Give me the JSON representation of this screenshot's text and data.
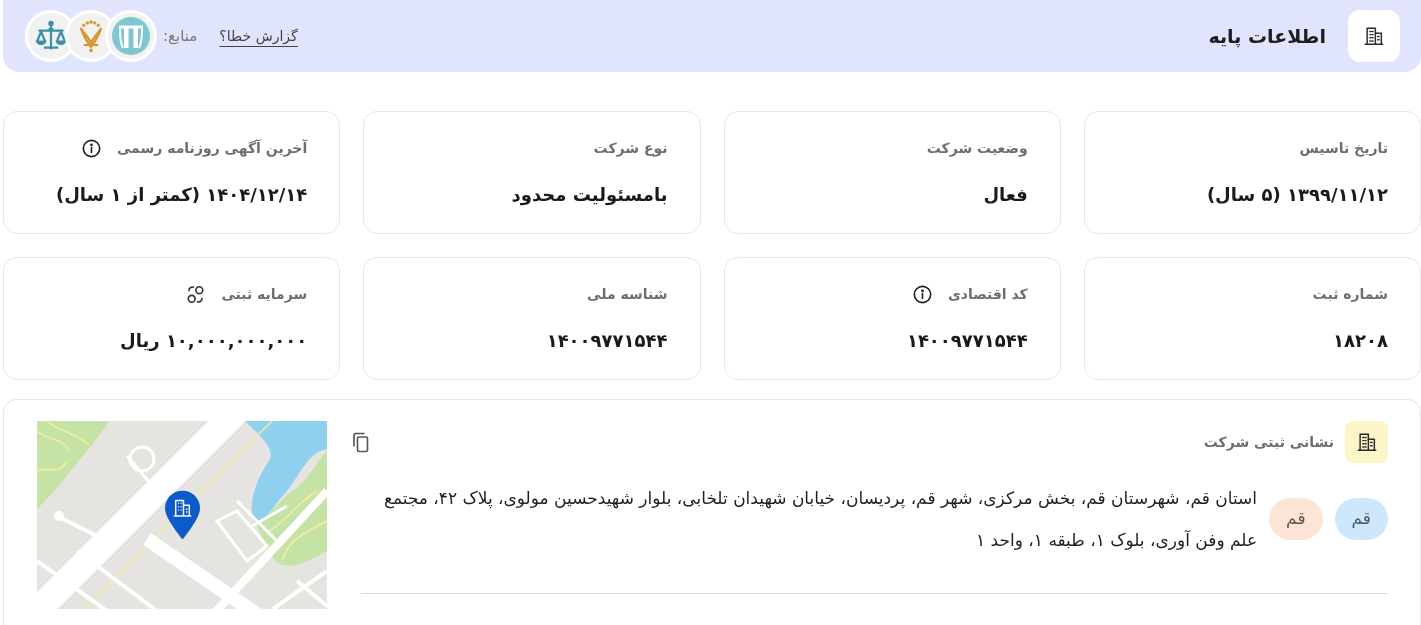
{
  "header": {
    "title": "اطلاعات پایه",
    "report_link": "گزارش خطا؟",
    "sources_label": "منابع:",
    "sources": [
      {
        "kind": "pillars"
      },
      {
        "kind": "crest"
      },
      {
        "kind": "scales"
      }
    ]
  },
  "fields": [
    {
      "label": "تاریخ تاسیس",
      "value": "۱۳۹۹/۱۱/۱۲ (۵ سال)",
      "kind": "plain"
    },
    {
      "label": "وضعیت شرکت",
      "value": "فعال",
      "kind": "plain"
    },
    {
      "label": "نوع شرکت",
      "value": "بامسئولیت محدود",
      "kind": "plain"
    },
    {
      "label": "آخرین آگهی روزنامه رسمی",
      "value": "۱۴۰۴/۱۲/۱۴ (کمتر از ۱ سال)",
      "kind": "info"
    },
    {
      "label": "شماره ثبت",
      "value": "۱۸۲۰۸",
      "kind": "plain"
    },
    {
      "label": "کد اقتصادی",
      "value": "۱۴۰۰۹۷۷۱۵۴۴",
      "kind": "info"
    },
    {
      "label": "شناسه ملی",
      "value": "۱۴۰۰۹۷۷۱۵۴۴",
      "kind": "plain"
    },
    {
      "label": "سرمایه ثبتی",
      "value": "۱۰,۰۰۰,۰۰۰,۰۰۰ ریال",
      "kind": "coins"
    }
  ],
  "address": {
    "title": "نشانی ثبتی شرکت",
    "tags": [
      {
        "label": "قم",
        "color": "#cde8fc"
      },
      {
        "label": "قم",
        "color": "#fce4d6"
      }
    ],
    "text": "استان قم، شهرستان قم، بخش مرکزی، شهر قم، پردیسان، خیابان شهیدان تلخابی، بلوار شهیدحسین مولوی، پلاک ۴۲، مجتمع علم وفن آوری، بلوک ۱، طبقه ۱، واحد ۱"
  }
}
